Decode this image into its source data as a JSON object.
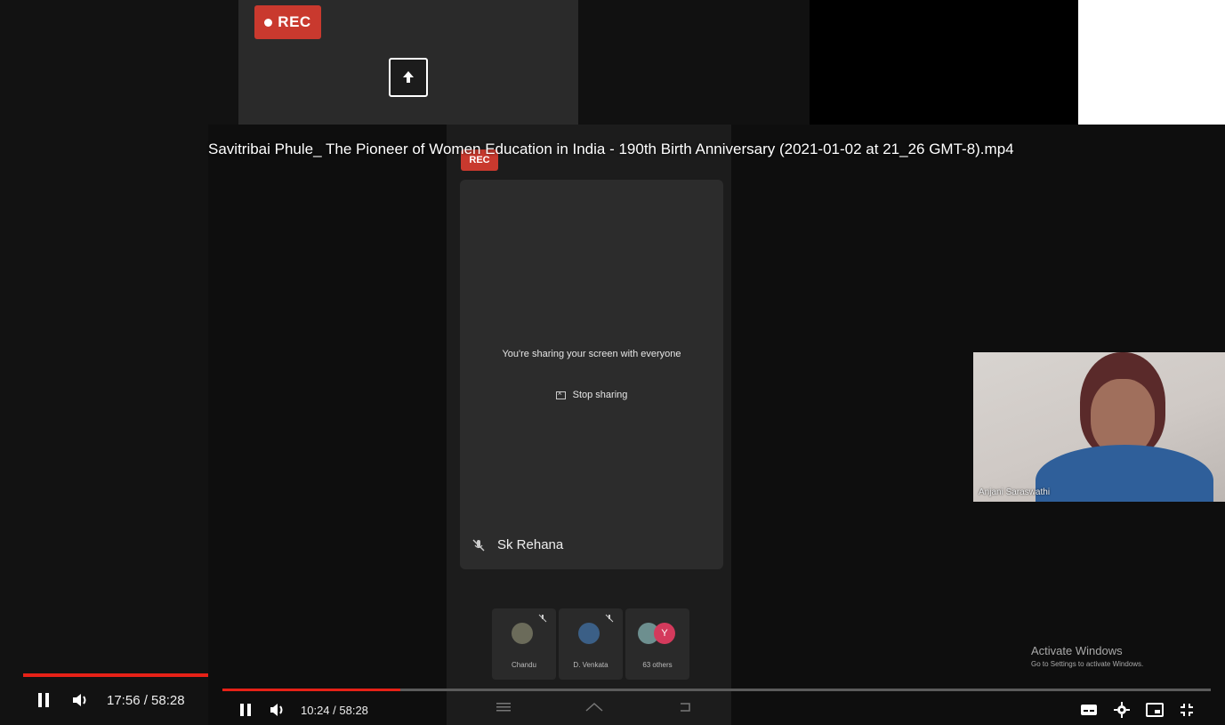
{
  "background_player": {
    "rec_label": "REC",
    "time": "17:56 / 58:28",
    "progress_percent": 100
  },
  "player": {
    "title": "Savitribai Phule_ The Pioneer of Women Education in India - 190th Birth Anniversary (2021-01-02 at 21_26 GMT-8).mp4",
    "time": "10:24 / 58:28",
    "progress_percent": 18
  },
  "meeting": {
    "rec_label": "REC",
    "share_message": "You're sharing your screen with everyone",
    "stop_sharing_label": "Stop sharing",
    "presenter_name": "Sk Rehana",
    "participants": [
      {
        "name": "Chandu"
      },
      {
        "name": "D. Venkata"
      },
      {
        "name": "63 others",
        "initial": "Y"
      }
    ],
    "camera_name": "Anjani Saraswathi"
  },
  "watermark": {
    "line1": "Activate Windows",
    "line2": "Go to Settings to activate Windows."
  },
  "colors": {
    "progress": "#e62117",
    "rec": "#c9392e"
  }
}
